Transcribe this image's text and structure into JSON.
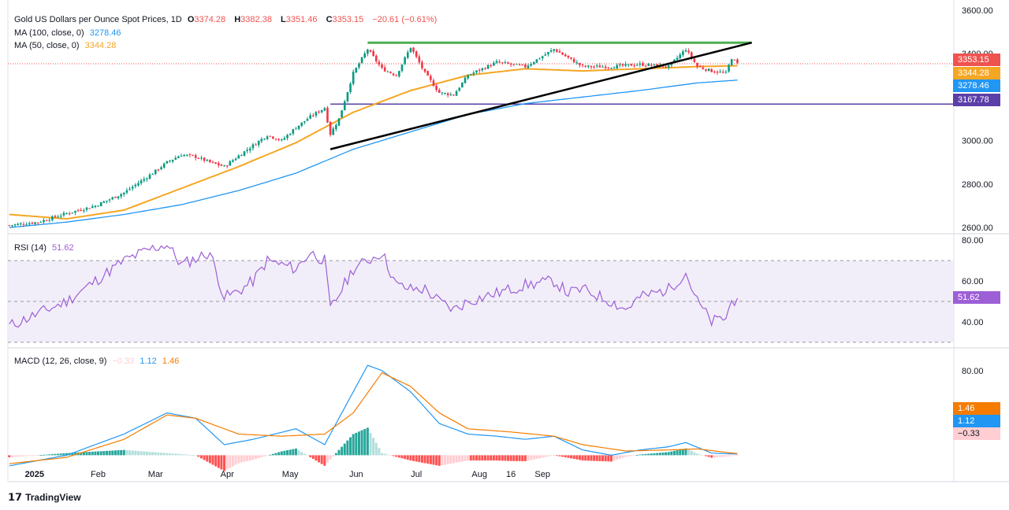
{
  "header": {
    "title": "Gold US Dollars per Ounce Spot Prices, 1D",
    "ohlc": [
      {
        "key": "O",
        "value": "3374.28"
      },
      {
        "key": "H",
        "value": "3382.38"
      },
      {
        "key": "L",
        "value": "3351.46"
      },
      {
        "key": "C",
        "value": "3353.15"
      }
    ],
    "change": "−20.61 (−0.61%)"
  },
  "indicators": {
    "ma100": {
      "label": "MA (100, close, 0)",
      "value": "3278.46",
      "color": "#2196f3"
    },
    "ma50": {
      "label": "MA (50, close, 0)",
      "value": "3344.28",
      "color": "#f5a623"
    },
    "rsi": {
      "label": "RSI (14)",
      "value": "51.62",
      "color": "#9c5fd6"
    },
    "macd": {
      "label": "MACD (12, 26, close, 9)",
      "hist_value": "−0.33",
      "macd_value": "1.12",
      "signal_value": "1.46"
    }
  },
  "price_tags": {
    "close": {
      "text": "3353.15",
      "color": "#ef5350"
    },
    "ma50": {
      "text": "3344.28",
      "color": "#f5a623"
    },
    "ma100": {
      "text": "3278.46",
      "color": "#2196f3"
    },
    "support": {
      "text": "3167.78",
      "color": "#5b3fa8"
    }
  },
  "macd_tags": {
    "signal": {
      "text": "1.46",
      "color": "#f57c00"
    },
    "macd": {
      "text": "1.12",
      "color": "#2196f3"
    },
    "hist": {
      "text": "−0.33",
      "color": "#ffcdd2"
    }
  },
  "x_axis_labels": [
    "2025",
    "Feb",
    "Mar",
    "Apr",
    "May",
    "Jun",
    "Jul",
    "Aug",
    "16",
    "Sep"
  ],
  "footer": {
    "brand": "TradingView"
  },
  "chart_data": [
    {
      "type": "line",
      "name": "price",
      "y_ticks": [
        2600,
        2800,
        3000,
        3200,
        3400,
        3600
      ],
      "y_tick_labels": [
        "2600.00",
        "2800.00",
        "3000.00",
        "3200.00",
        "3400.00",
        "3600.00"
      ],
      "ylim": [
        2575,
        3610
      ],
      "close_path": [
        [
          0,
          2610
        ],
        [
          10,
          2625
        ],
        [
          20,
          2665
        ],
        [
          30,
          2700
        ],
        [
          40,
          2760
        ],
        [
          50,
          2850
        ],
        [
          55,
          2900
        ],
        [
          60,
          2935
        ],
        [
          65,
          2925
        ],
        [
          70,
          2900
        ],
        [
          75,
          2880
        ],
        [
          80,
          2930
        ],
        [
          90,
          3025
        ],
        [
          95,
          3000
        ],
        [
          100,
          3060
        ],
        [
          105,
          3110
        ],
        [
          110,
          3150
        ],
        [
          112,
          3030
        ],
        [
          115,
          3100
        ],
        [
          120,
          3310
        ],
        [
          125,
          3420
        ],
        [
          130,
          3330
        ],
        [
          135,
          3300
        ],
        [
          140,
          3430
        ],
        [
          145,
          3310
        ],
        [
          150,
          3220
        ],
        [
          155,
          3210
        ],
        [
          160,
          3300
        ],
        [
          170,
          3360
        ],
        [
          180,
          3340
        ],
        [
          190,
          3420
        ],
        [
          195,
          3380
        ],
        [
          200,
          3340
        ],
        [
          210,
          3340
        ],
        [
          220,
          3350
        ],
        [
          230,
          3340
        ],
        [
          236,
          3420
        ],
        [
          240,
          3340
        ],
        [
          245,
          3320
        ],
        [
          250,
          3310
        ],
        [
          252,
          3380
        ],
        [
          254,
          3353
        ]
      ],
      "ma50": [
        [
          0,
          2660
        ],
        [
          20,
          2640
        ],
        [
          40,
          2680
        ],
        [
          60,
          2780
        ],
        [
          80,
          2880
        ],
        [
          100,
          2990
        ],
        [
          120,
          3130
        ],
        [
          140,
          3230
        ],
        [
          160,
          3300
        ],
        [
          180,
          3330
        ],
        [
          200,
          3320
        ],
        [
          220,
          3330
        ],
        [
          240,
          3340
        ],
        [
          254,
          3344
        ]
      ],
      "ma100": [
        [
          0,
          2600
        ],
        [
          20,
          2625
        ],
        [
          40,
          2660
        ],
        [
          60,
          2705
        ],
        [
          80,
          2770
        ],
        [
          100,
          2850
        ],
        [
          120,
          2960
        ],
        [
          140,
          3040
        ],
        [
          160,
          3120
        ],
        [
          180,
          3170
        ],
        [
          200,
          3200
        ],
        [
          220,
          3230
        ],
        [
          240,
          3265
        ],
        [
          254,
          3278
        ]
      ],
      "resistance": 3450,
      "support": 3167.78,
      "trendline": [
        [
          112,
          2960
        ],
        [
          259,
          3450
        ]
      ]
    },
    {
      "type": "line",
      "name": "RSI (14)",
      "y_ticks": [
        40,
        60,
        80
      ],
      "y_tick_labels": [
        "40.00",
        "60.00",
        "80.00"
      ],
      "ylim": [
        28,
        82
      ],
      "band": [
        30,
        70
      ],
      "midline": 50,
      "values": [
        [
          0,
          38
        ],
        [
          20,
          50
        ],
        [
          30,
          60
        ],
        [
          40,
          70
        ],
        [
          50,
          76
        ],
        [
          55,
          78
        ],
        [
          60,
          68
        ],
        [
          70,
          74
        ],
        [
          75,
          52
        ],
        [
          80,
          55
        ],
        [
          85,
          60
        ],
        [
          90,
          70
        ],
        [
          100,
          66
        ],
        [
          105,
          74
        ],
        [
          110,
          70
        ],
        [
          112,
          46
        ],
        [
          120,
          66
        ],
        [
          130,
          74
        ],
        [
          135,
          58
        ],
        [
          140,
          56
        ],
        [
          145,
          56
        ],
        [
          150,
          50
        ],
        [
          155,
          46
        ],
        [
          160,
          50
        ],
        [
          170,
          54
        ],
        [
          180,
          58
        ],
        [
          190,
          60
        ],
        [
          195,
          54
        ],
        [
          200,
          56
        ],
        [
          210,
          50
        ],
        [
          215,
          46
        ],
        [
          220,
          52
        ],
        [
          230,
          56
        ],
        [
          236,
          64
        ],
        [
          240,
          50
        ],
        [
          245,
          40
        ],
        [
          250,
          42
        ],
        [
          252,
          50
        ],
        [
          254,
          51.62
        ]
      ]
    },
    {
      "type": "line",
      "name": "MACD (12, 26, close, 9)",
      "y_ticks": [
        80
      ],
      "y_tick_labels": [
        "80.00"
      ],
      "ylim": [
        -25,
        100
      ],
      "macd": [
        [
          0,
          -10
        ],
        [
          20,
          0
        ],
        [
          40,
          20
        ],
        [
          55,
          40
        ],
        [
          65,
          35
        ],
        [
          75,
          10
        ],
        [
          85,
          15
        ],
        [
          100,
          25
        ],
        [
          110,
          10
        ],
        [
          120,
          60
        ],
        [
          125,
          85
        ],
        [
          130,
          80
        ],
        [
          140,
          60
        ],
        [
          150,
          30
        ],
        [
          160,
          20
        ],
        [
          170,
          18
        ],
        [
          180,
          15
        ],
        [
          190,
          18
        ],
        [
          200,
          5
        ],
        [
          210,
          0
        ],
        [
          220,
          5
        ],
        [
          230,
          8
        ],
        [
          236,
          12
        ],
        [
          245,
          2
        ],
        [
          254,
          1.12
        ]
      ],
      "signal": [
        [
          0,
          -8
        ],
        [
          20,
          -2
        ],
        [
          40,
          15
        ],
        [
          55,
          38
        ],
        [
          65,
          35
        ],
        [
          80,
          20
        ],
        [
          95,
          18
        ],
        [
          110,
          20
        ],
        [
          120,
          40
        ],
        [
          130,
          78
        ],
        [
          140,
          65
        ],
        [
          150,
          40
        ],
        [
          160,
          25
        ],
        [
          175,
          22
        ],
        [
          190,
          18
        ],
        [
          200,
          10
        ],
        [
          215,
          4
        ],
        [
          230,
          5
        ],
        [
          240,
          6
        ],
        [
          254,
          1.46
        ]
      ]
    }
  ]
}
